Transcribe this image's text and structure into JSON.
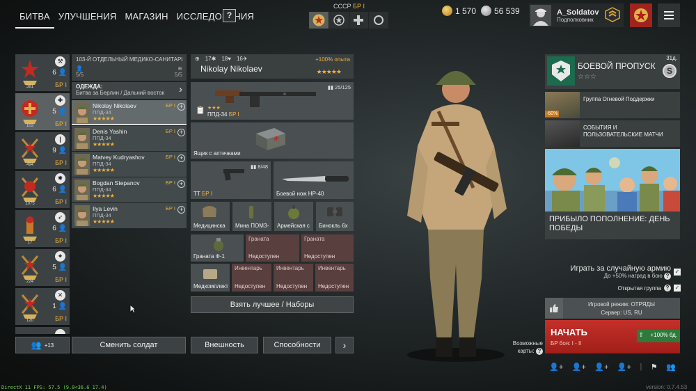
{
  "topnav": {
    "tabs": [
      "БИТВА",
      "УЛУЧШЕНИЯ",
      "МАГАЗИН",
      "ИССЛЕДОВАНИЯ"
    ],
    "help": "?"
  },
  "nation": {
    "name": "СССР",
    "br": "БР I"
  },
  "currency": {
    "gold": "1 570",
    "silver": "56 539"
  },
  "profile": {
    "name": "A_Soldatov",
    "rank": "Подполковник"
  },
  "squads": [
    {
      "count": "6",
      "br": "БР I",
      "level": "381",
      "icon": "wrench-icon"
    },
    {
      "count": "5",
      "br": "БР I",
      "level": "103",
      "icon": "medic-cross-icon"
    },
    {
      "count": "9",
      "br": "БР I",
      "level": "494",
      "icon": "bullet-icon"
    },
    {
      "count": "6",
      "br": "БР I",
      "level": "1075",
      "icon": "explosion-icon"
    },
    {
      "count": "6",
      "br": "БР I",
      "level": "17",
      "icon": "rocket-icon"
    },
    {
      "count": "5",
      "br": "БР I",
      "level": "224",
      "icon": "crosshair-icon"
    },
    {
      "count": "1",
      "br": "БР I",
      "level": "120",
      "icon": "crossed-tools-icon"
    }
  ],
  "squad_detail": {
    "title": "103-Й ОТДЕЛЬНЫЙ МЕДИКО-САНИТАРН",
    "left_count": "5/5",
    "right_count": "5/5",
    "outfit_label": "ОДЕЖДА:",
    "outfit_value": "Битва за Берлин / Дальний восток"
  },
  "soldiers": [
    {
      "name": "Nikolay Nikolaev",
      "weapon": "ППД-34",
      "br": "БР I",
      "stars": "★★★★★"
    },
    {
      "name": "Denis Yashin",
      "weapon": "ППД-34",
      "br": "БР I",
      "stars": "★★★★★"
    },
    {
      "name": "Matvey Kudryashov",
      "weapon": "ППД-34",
      "br": "БР I",
      "stars": "★★★★★"
    },
    {
      "name": "Bogdan Stepanov",
      "weapon": "ППД-34",
      "br": "БР I",
      "stars": "★★★★★"
    },
    {
      "name": "Ilya Levin",
      "weapon": "ППД-34",
      "br": "БР I",
      "stars": "★★★★★"
    }
  ],
  "soldier_header": {
    "stat1": "17",
    "stat2": "18",
    "stat3": "16",
    "xp_bonus": "+100% опыта",
    "name": "Nikolay Nikolaev",
    "stars": "★★★★★"
  },
  "equipment": {
    "primary": {
      "name": "ППД-34",
      "br": "БР I",
      "ammo": "25/125",
      "stars": "★★★"
    },
    "backpack": {
      "name": "Ящик с аптечками"
    },
    "secondary": {
      "name": "ТТ",
      "br": "БР I",
      "ammo": "8/48"
    },
    "melee": {
      "name": "Боевой нож НР-40"
    },
    "items": [
      "Медицинска",
      "Мина ПОМЗ-",
      "Армейская с",
      "Бинокль 6х"
    ],
    "grenade": "Граната Ф-1",
    "locked_grenade_top": "Граната",
    "locked_text": "Недоступен",
    "medkit": "Медкомплект",
    "locked_inventory_top": "Инвентарь"
  },
  "buttons": {
    "take_best": "Взять лучшее / Наборы",
    "squad_count": "+13",
    "change_soldier": "Сменить солдат",
    "appearance": "Внешность",
    "abilities": "Способности",
    "next": "›"
  },
  "right": {
    "battlepass_title": "БОЕВОЙ ПРОПУСК",
    "battlepass_days": "31д.",
    "battlepass_stars": "☆☆☆",
    "battlepass_icon": "S",
    "promo1": "Группа Огневой Поддержки",
    "promo1_sale": "-60%",
    "promo2": "СОБЫТИЯ И ПОЛЬЗОВАТЕЛЬСКИЕ МАТЧИ",
    "banner": "ПРИБЫЛО ПОПОЛНЕНИЕ: ДЕНЬ ПОБЕДЫ",
    "random_army": "Играть за случайную армию",
    "random_army_sub": "До +50% наград в бою",
    "open_group": "Открытая группа",
    "game_mode": "Игровой режим: ОТРЯДЫ",
    "server": "Сервер: US, RU",
    "start": "НАЧАТЬ",
    "start_br": "БР боя: I - II",
    "start_xp": "+100% бд.",
    "maps": "Возможные карты:"
  },
  "footer": {
    "fps": "DirectX 11 FPS: 57.5 (9.0<36.6 17.4)",
    "version": "version: 0.7.4.53"
  },
  "colors": {
    "accent": "#f0b03c",
    "start": "#c4302a",
    "locked": "#5a3f3f",
    "xp": "#2e7a3a"
  }
}
